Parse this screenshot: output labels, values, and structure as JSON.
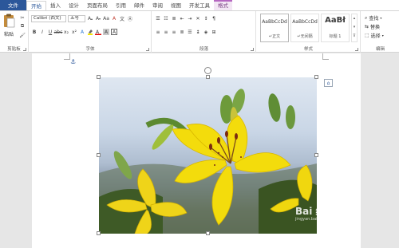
{
  "tabs": [
    {
      "label": "文件",
      "kind": "file"
    },
    {
      "label": "开始",
      "kind": "active"
    },
    {
      "label": "插入",
      "kind": "normal"
    },
    {
      "label": "设计",
      "kind": "normal"
    },
    {
      "label": "页面布局",
      "kind": "normal"
    },
    {
      "label": "引用",
      "kind": "normal"
    },
    {
      "label": "邮件",
      "kind": "normal"
    },
    {
      "label": "审阅",
      "kind": "normal"
    },
    {
      "label": "视图",
      "kind": "normal"
    },
    {
      "label": "开发工具",
      "kind": "normal"
    },
    {
      "label": "格式",
      "kind": "contextual"
    }
  ],
  "clipboard": {
    "paste_label": "粘贴",
    "group_label": "剪贴板"
  },
  "font": {
    "name_value": "Calibri (西文)",
    "size_value": "五号",
    "group_label": "字体",
    "font_color": "#e00000",
    "highlight_color": "#f2e600"
  },
  "paragraph": {
    "group_label": "段落"
  },
  "styles": {
    "group_label": "样式",
    "items": [
      {
        "sample": "AaBbCcDd",
        "name": "↵正文"
      },
      {
        "sample": "AaBbCcDd",
        "name": "↵无间隔"
      },
      {
        "sample": "AaBł",
        "name": "标题 1"
      }
    ]
  },
  "editing": {
    "find_label": "查找",
    "replace_label": "替换",
    "select_label": "选择",
    "group_label": "编辑"
  },
  "accent_color": "#2b579a",
  "watermark": {
    "text": "Bai 经验",
    "sub": "jingyan.baidu.com"
  }
}
